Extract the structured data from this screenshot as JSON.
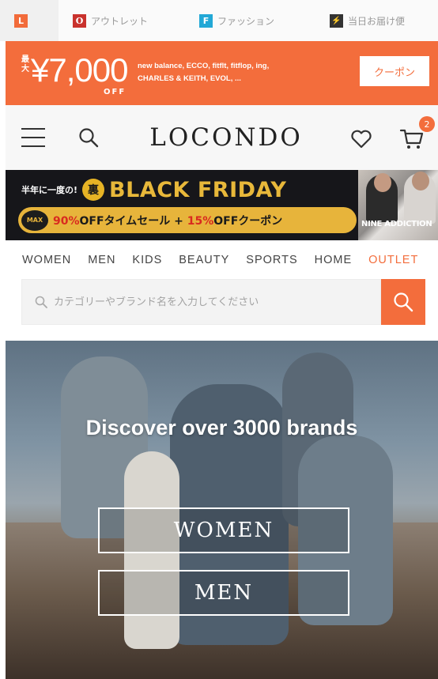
{
  "service_tabs": [
    {
      "icon": "L",
      "label": ""
    },
    {
      "icon": "O",
      "label": "アウトレット"
    },
    {
      "icon": "F",
      "label": "ファッション"
    },
    {
      "icon": "⚡",
      "label": "当日お届け便"
    }
  ],
  "promo": {
    "max_label": "最大",
    "amount": "¥7,000",
    "off_label": "OFF",
    "brands_line1": "new balance, ECCO, fitflt, fitflop, ing,",
    "brands_line2": "CHARLES & KEITH, EVOL, ...",
    "coupon_button": "クーポン"
  },
  "header": {
    "logo": "LOCONDO",
    "cart_count": "2"
  },
  "black_friday": {
    "pre_text": "半年に一度の!",
    "ura_badge": "裏",
    "title": "BLACK FRIDAY",
    "max_badge": "MAX",
    "sale_pct": "90%",
    "sale_mid": "OFFタイムセール + ",
    "coupon_pct": "15%",
    "sale_tail": "OFFクーポン",
    "side_brand": "NINE ADDICTION"
  },
  "category_nav": [
    "WOMEN",
    "MEN",
    "KIDS",
    "BEAUTY",
    "SPORTS",
    "HOME",
    "OUTLET"
  ],
  "search": {
    "placeholder": "カテゴリーやブランド名を入力してください"
  },
  "hero": {
    "title": "Discover over 3000 brands",
    "women_button": "WOMEN",
    "men_button": "MEN"
  },
  "colors": {
    "accent": "#f36d3c",
    "black_friday_gold": "#e7b43b",
    "header_bg": "#f7f7f7"
  }
}
